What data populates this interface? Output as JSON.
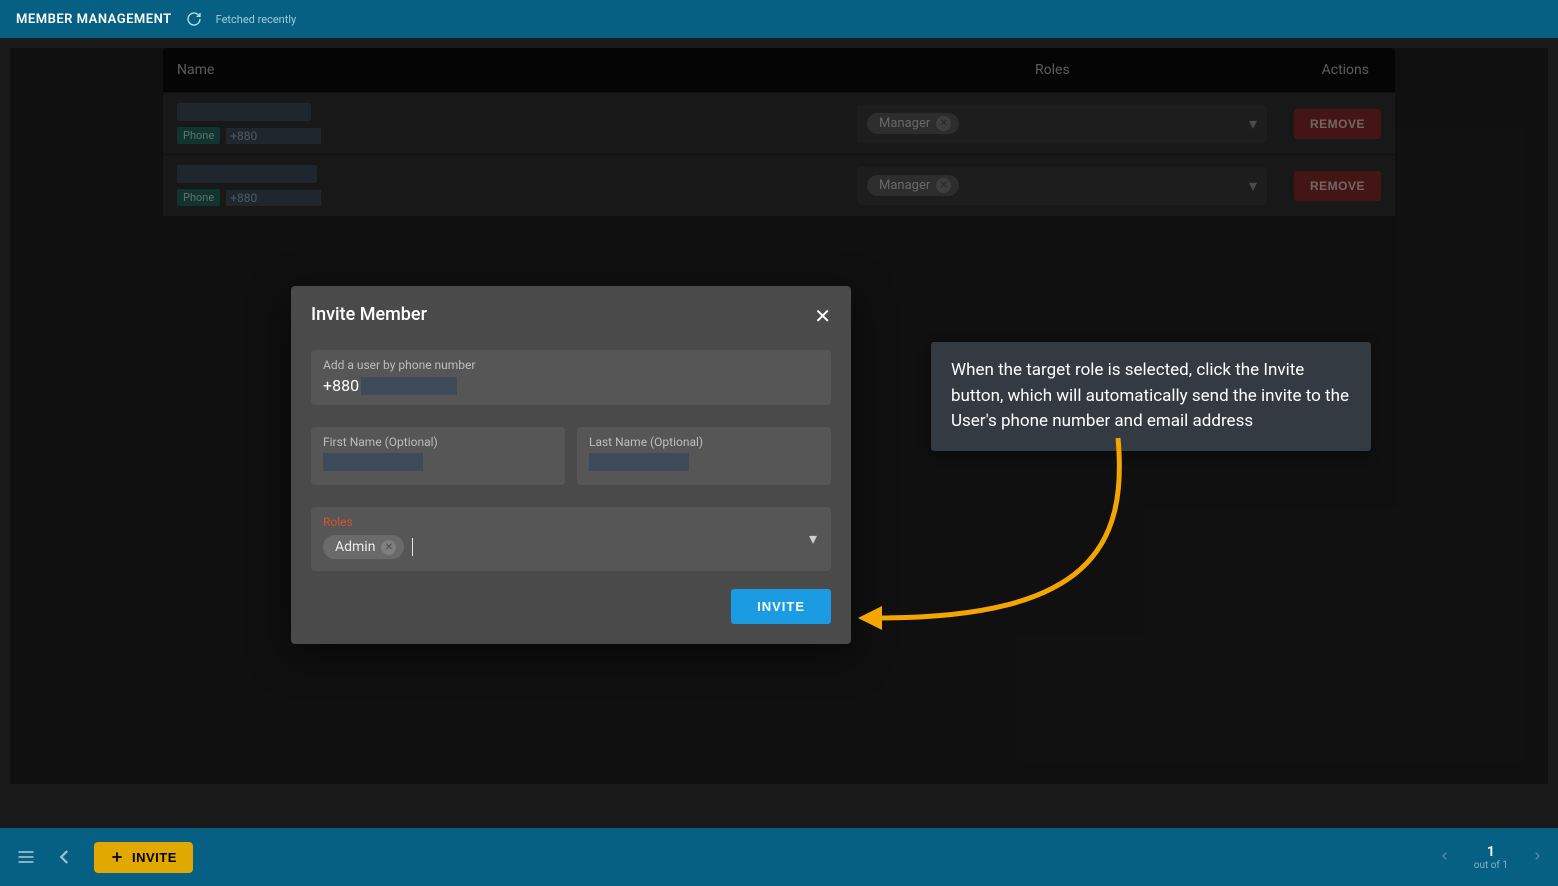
{
  "topbar": {
    "title": "MEMBER MANAGEMENT",
    "fetched_text": "Fetched recently"
  },
  "table": {
    "headers": {
      "name": "Name",
      "roles": "Roles",
      "actions": "Actions"
    },
    "phone_badge": "Phone",
    "phone_prefix": "+880",
    "remove_label": "REMOVE",
    "rows": [
      {
        "role": "Manager"
      },
      {
        "role": "Manager"
      }
    ]
  },
  "modal": {
    "title": "Invite Member",
    "phone_label": "Add a user by phone number",
    "phone_prefix": "+880",
    "first_name_label": "First Name (Optional)",
    "last_name_label": "Last Name (Optional)",
    "roles_label": "Roles",
    "selected_role": "Admin",
    "invite_label": "INVITE"
  },
  "callout": {
    "text": "When the target role is selected, click the Invite button, which will automatically send the invite to the User's phone number and email address"
  },
  "bottombar": {
    "invite_label": "INVITE",
    "page_num": "1",
    "page_sub": "out of 1"
  }
}
